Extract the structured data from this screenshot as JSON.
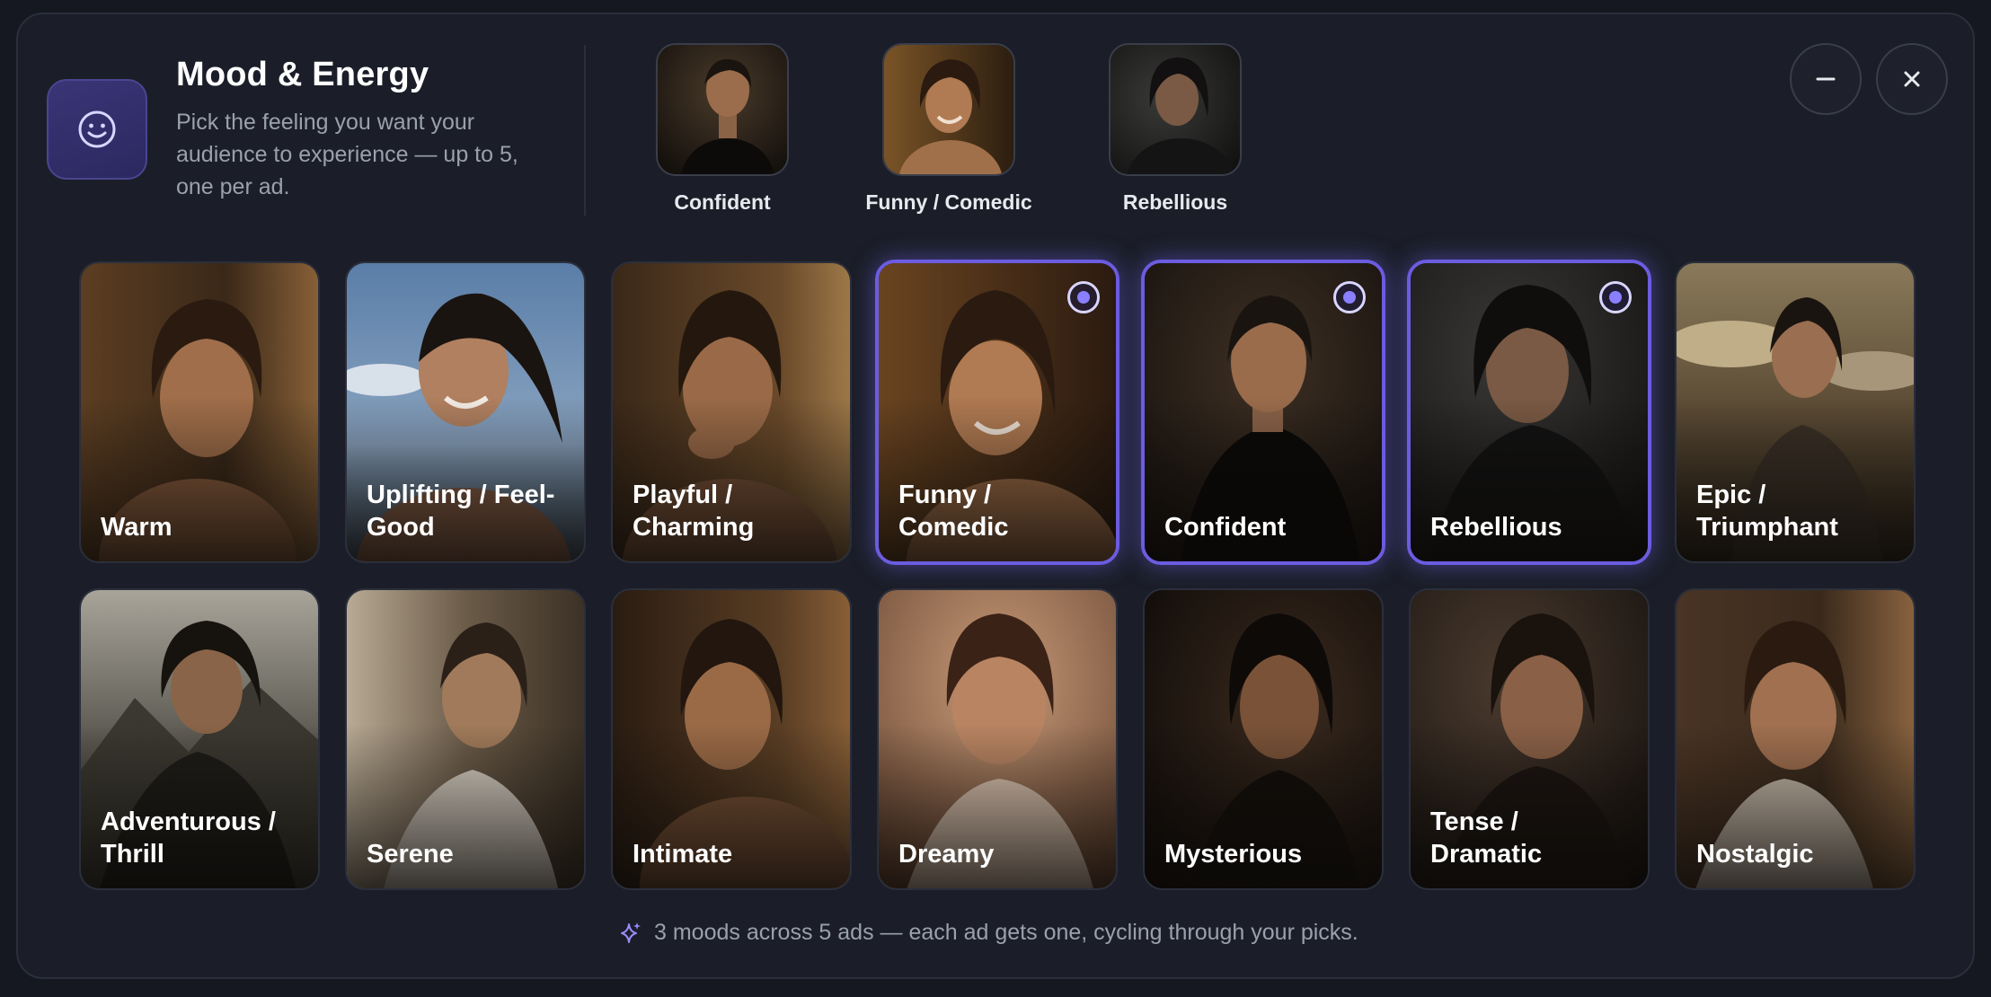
{
  "header": {
    "title": "Mood & Energy",
    "subtitle": "Pick the feeling you want your audience to experience — up to 5, one per ad.",
    "icon": "smiley-icon",
    "accent_color": "#6b5ce0"
  },
  "selected": [
    {
      "label": "Confident"
    },
    {
      "label": "Funny / Comedic"
    },
    {
      "label": "Rebellious"
    }
  ],
  "window_controls": {
    "minimize_icon": "minus-icon",
    "close_icon": "close-icon"
  },
  "moods": [
    {
      "label": "Warm",
      "selected": false
    },
    {
      "label": "Uplifting / Feel-Good",
      "selected": false
    },
    {
      "label": "Playful / Charming",
      "selected": false
    },
    {
      "label": "Funny / Comedic",
      "selected": true
    },
    {
      "label": "Confident",
      "selected": true
    },
    {
      "label": "Rebellious",
      "selected": true
    },
    {
      "label": "Epic / Triumphant",
      "selected": false
    },
    {
      "label": "Adventurous / Thrill",
      "selected": false
    },
    {
      "label": "Serene",
      "selected": false
    },
    {
      "label": "Intimate",
      "selected": false
    },
    {
      "label": "Dreamy",
      "selected": false
    },
    {
      "label": "Mysterious",
      "selected": false
    },
    {
      "label": "Tense / Dramatic",
      "selected": false
    },
    {
      "label": "Nostalgic",
      "selected": false
    }
  ],
  "footer": {
    "icon": "sparkle-icon",
    "text": "3 moods across 5 ads — each ad gets one, cycling through your picks."
  }
}
